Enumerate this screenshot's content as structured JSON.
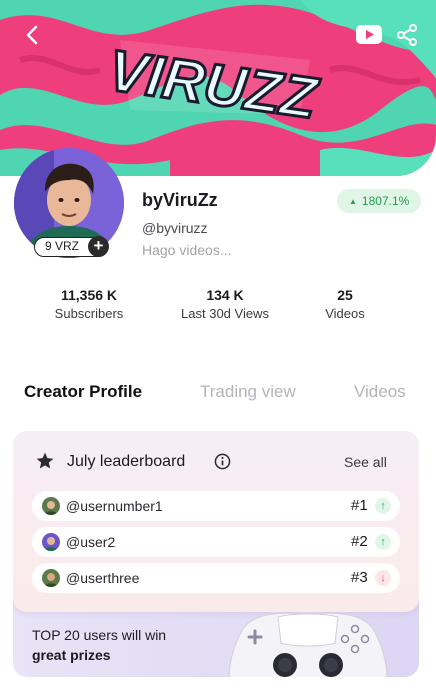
{
  "header": {
    "logo_text": "VIRUZZ",
    "back_icon": "chevron-left-icon",
    "youtube_icon": "youtube-icon",
    "share_icon": "share-icon"
  },
  "profile": {
    "token_badge": "9 VRZ",
    "add_icon": "plus-icon",
    "name": "byViruZz",
    "handle": "@byviruzz",
    "bio": "Hago videos...",
    "growth": "1807.1%",
    "growth_color": "#2a9a55"
  },
  "stats": [
    {
      "value": "11,356 K",
      "label": "Subscribers"
    },
    {
      "value": "134 K",
      "label": "Last 30d Views"
    },
    {
      "value": "25",
      "label": "Videos"
    }
  ],
  "tabs": [
    {
      "label": "Creator Profile",
      "active": true
    },
    {
      "label": "Trading view",
      "active": false
    },
    {
      "label": "Videos",
      "active": false
    }
  ],
  "leaderboard": {
    "title": "July leaderboard",
    "see_all": "See all",
    "rows": [
      {
        "user": "@usernumber1",
        "rank": "#1",
        "trend": "up"
      },
      {
        "user": "@user2",
        "rank": "#2",
        "trend": "up"
      },
      {
        "user": "@userthree",
        "rank": "#3",
        "trend": "down"
      }
    ]
  },
  "promo": {
    "line1": "TOP 20 users will win",
    "line2": "great prizes"
  },
  "colors": {
    "banner_pink": "#ee3f7c",
    "banner_teal": "#4fd5b2",
    "accent_green": "#35b06a",
    "accent_red": "#e0566f"
  }
}
